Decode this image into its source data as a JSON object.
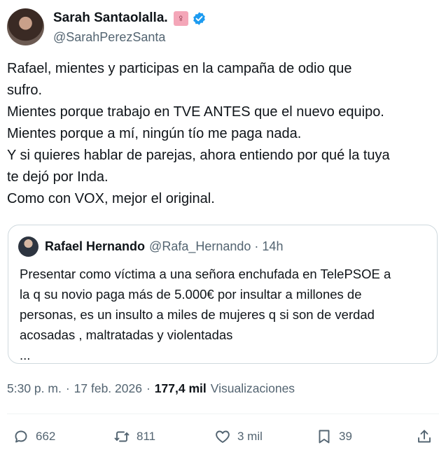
{
  "author": {
    "display_name": "Sarah Santaolalla.",
    "handle": "@SarahPerezSanta",
    "badge_symbol": "♀",
    "verified_color": "#1d9bf0"
  },
  "tweet": {
    "lines": [
      "Rafael, mientes y participas en la campaña de odio que",
      "sufro.",
      "Mientes porque trabajo en TVE ANTES que el nuevo equipo.",
      "Mientes porque a mí, ningún tío me paga nada.",
      "Y si quieres hablar de parejas, ahora entiendo por qué la tuya",
      "te dejó por Inda.",
      "Como con VOX, mejor el original."
    ]
  },
  "quote": {
    "display_name": "Rafael Hernando",
    "handle": "@Rafa_Hernando",
    "separator": "·",
    "time": "14h",
    "lines": [
      "Presentar como víctima a una señora enchufada en TelePSOE a",
      "la q su novio paga más de 5.000€ por insultar a millones de",
      "personas, es un insulto a miles de mujeres q si son de verdad",
      "acosadas , maltratadas y violentadas",
      "..."
    ]
  },
  "meta": {
    "time": "5:30 p. m.",
    "separator": "·",
    "date": "17 feb. 2026",
    "views_count": "177,4 mil",
    "views_label": "Visualizaciones"
  },
  "actions": {
    "replies": "662",
    "reposts": "811",
    "likes": "3 mil",
    "bookmarks": "39"
  }
}
